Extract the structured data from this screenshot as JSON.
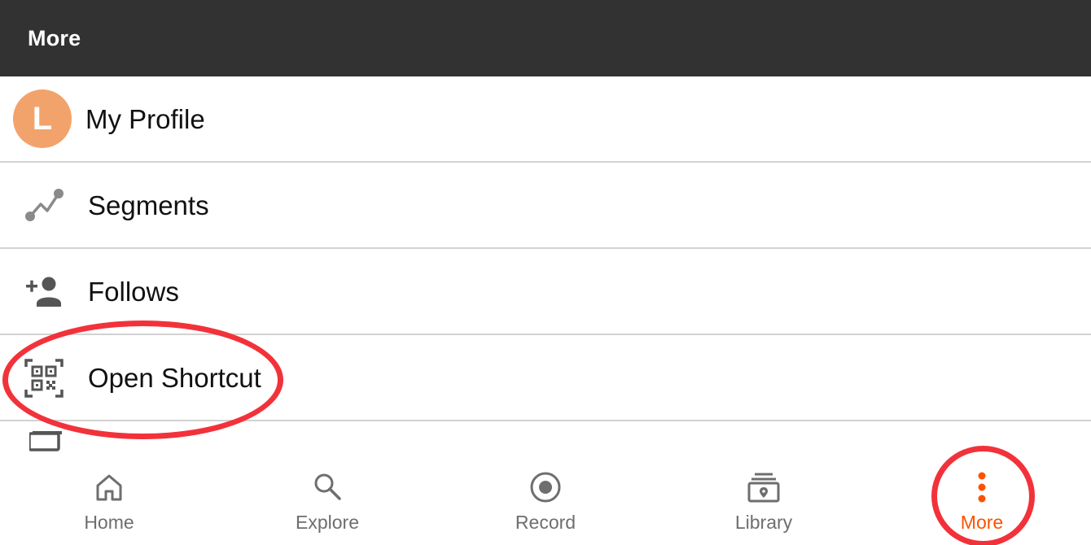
{
  "header": {
    "title": "More"
  },
  "profile": {
    "avatar_letter": "L",
    "label": "My Profile"
  },
  "menu": {
    "items": [
      {
        "label": "Segments",
        "icon": "segments-icon"
      },
      {
        "label": "Follows",
        "icon": "add-person-icon"
      },
      {
        "label": "Open Shortcut",
        "icon": "qr-code-icon"
      }
    ]
  },
  "bottom_nav": {
    "items": [
      {
        "label": "Home",
        "icon": "home-icon"
      },
      {
        "label": "Explore",
        "icon": "search-icon"
      },
      {
        "label": "Record",
        "icon": "record-icon"
      },
      {
        "label": "Library",
        "icon": "library-icon"
      },
      {
        "label": "More",
        "icon": "more-vertical-icon",
        "active": true
      }
    ]
  },
  "colors": {
    "header_bg": "#323232",
    "accent": "#fc5200",
    "annotation": "#f2323a",
    "avatar_bg": "#f2a36b"
  }
}
